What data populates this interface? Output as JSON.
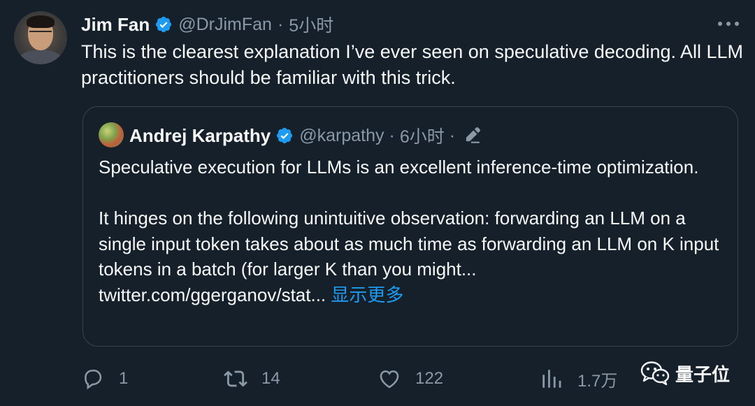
{
  "tweet": {
    "author_name": "Jim Fan",
    "handle": "@DrJimFan",
    "separator": "·",
    "time": "5小时",
    "text": "This is the clearest explanation I’ve ever seen on speculative decoding. All LLM practitioners should be familiar with this trick.",
    "verified_color": "#1d9bf0"
  },
  "quote": {
    "author_name": "Andrej Karpathy",
    "handle": "@karpathy",
    "separator": "·",
    "time": "6小时",
    "separator2": "·",
    "paragraph1": "Speculative execution for LLMs is an excellent inference-time optimization.",
    "paragraph2": "It hinges on the following unintuitive observation: forwarding an LLM on a single input token takes about as much time as forwarding an LLM on K input tokens in a batch (for larger K than you might...",
    "link_text": "twitter.com/ggerganov/stat...",
    "show_more": "显示更多"
  },
  "actions": {
    "reply_count": "1",
    "retweet_count": "14",
    "like_count": "122",
    "views_count": "1.7万"
  },
  "watermark": {
    "text": "量子位"
  },
  "icons": {
    "verified": "verified-badge-icon",
    "edit": "pencil-edit-icon",
    "more": "more-dots-icon",
    "reply": "reply-bubble-icon",
    "retweet": "retweet-icon",
    "like": "heart-icon",
    "views": "bar-chart-icon",
    "wechat": "wechat-icon"
  },
  "colors": {
    "background": "#15202b",
    "text": "#f7f9f9",
    "secondary": "#8b98a5",
    "accent": "#1d9bf0",
    "border": "#38444d"
  }
}
